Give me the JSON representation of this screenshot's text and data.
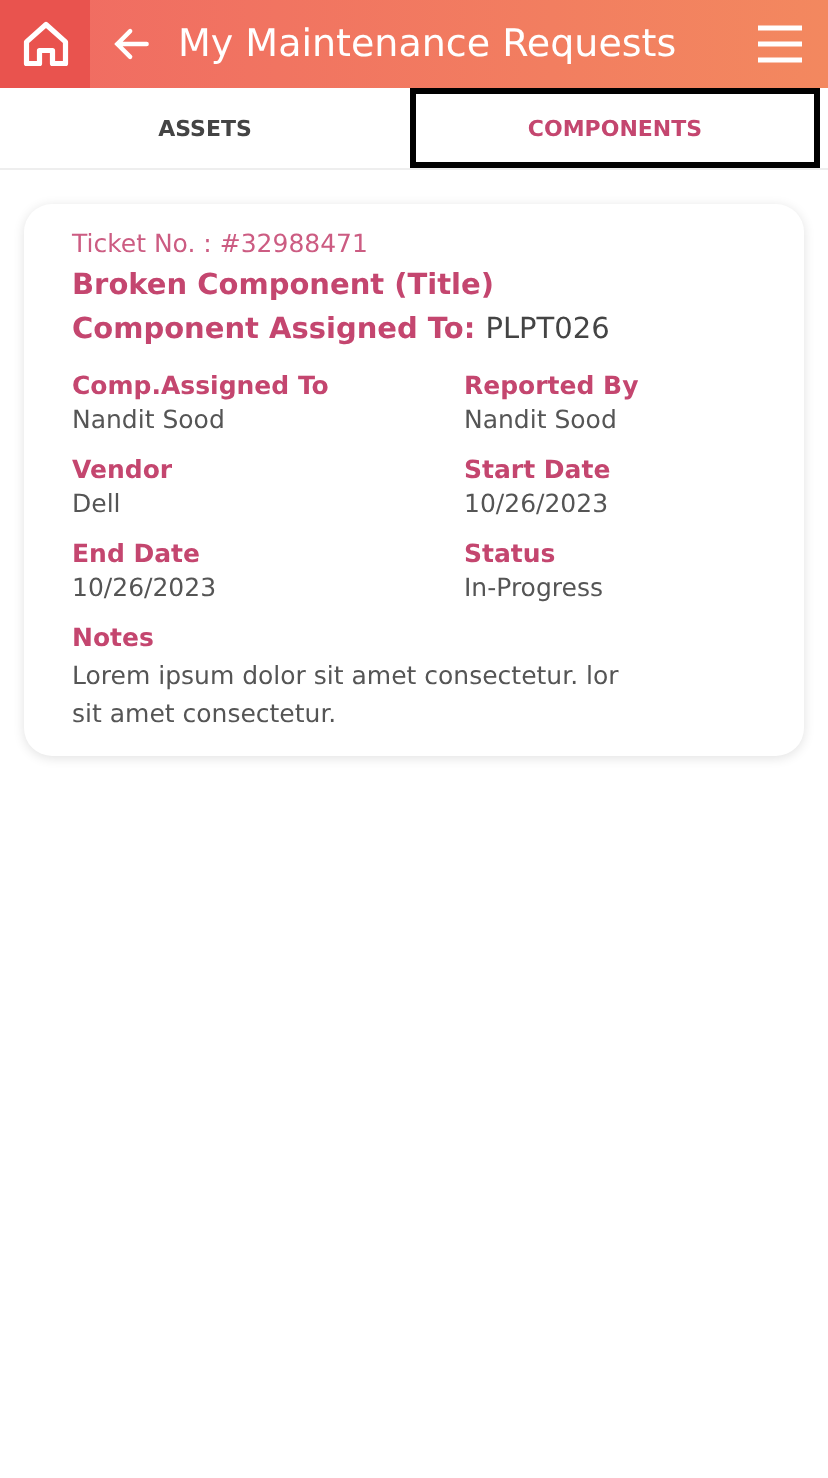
{
  "header": {
    "title": "My Maintenance Requests"
  },
  "tabs": [
    {
      "label": "ASSETS",
      "selected": false,
      "highlighted": false
    },
    {
      "label": "COMPONENTS",
      "selected": true,
      "highlighted": true
    }
  ],
  "card": {
    "ticket": "Ticket No. : #32988471",
    "title": "Broken Component (Title)",
    "assigned_label": "Component Assigned To:",
    "assigned_value": "PLPT026",
    "fields": [
      {
        "label": "Comp.Assigned To",
        "value": "Nandit Sood"
      },
      {
        "label": "Reported By",
        "value": "Nandit Sood"
      },
      {
        "label": "Vendor",
        "value": "Dell"
      },
      {
        "label": "Start Date",
        "value": "10/26/2023"
      },
      {
        "label": "End Date",
        "value": "10/26/2023"
      },
      {
        "label": "Status",
        "value": "In-Progress"
      }
    ],
    "notes_label": "Notes",
    "notes": "Lorem ipsum dolor sit amet consectetur. lor sit amet consectetur."
  }
}
